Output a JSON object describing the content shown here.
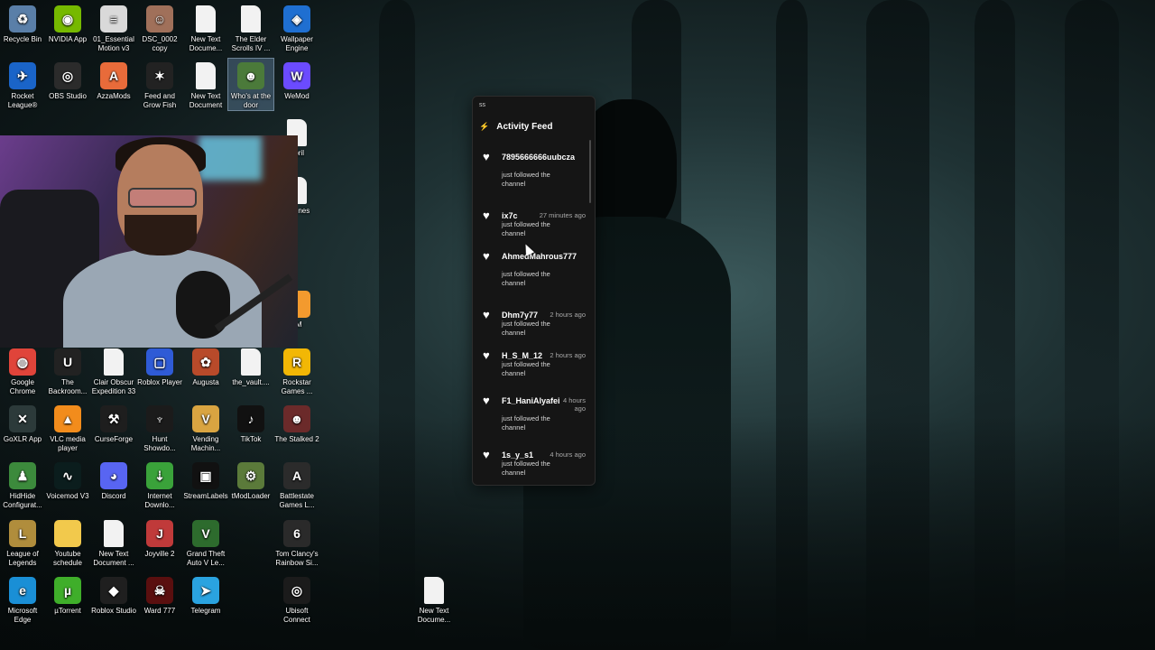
{
  "desktop": {
    "icons_top": [
      {
        "label": "Recycle Bin",
        "icon": "recycle-bin-icon",
        "color": "#5a7fa8",
        "glyph": "♻"
      },
      {
        "label": "NVIDIA App",
        "icon": "nvidia-icon",
        "color": "#76b900",
        "glyph": "◉"
      },
      {
        "label": "01_Essential Motion v3",
        "icon": "preset-file-icon",
        "color": "#d9d9d9",
        "glyph": "≡"
      },
      {
        "label": "DSC_0002 copy",
        "icon": "photo-icon",
        "color": "#a0705a",
        "glyph": "☺"
      },
      {
        "label": "New Text Docume...",
        "icon": "text-file-icon",
        "color": "#f2f2f2",
        "glyph": ""
      },
      {
        "label": "The Elder Scrolls IV ...",
        "icon": "text-file-icon",
        "color": "#f2f2f2",
        "glyph": ""
      },
      {
        "label": "Wallpaper Engine",
        "icon": "wallpaper-engine-icon",
        "color": "#1f6fd1",
        "glyph": "◈"
      }
    ],
    "icons_row2": [
      {
        "label": "Rocket League®",
        "icon": "rocket-league-icon",
        "color": "#1a64c8",
        "glyph": "✈"
      },
      {
        "label": "OBS Studio",
        "icon": "obs-icon",
        "color": "#2b2b2b",
        "glyph": "◎"
      },
      {
        "label": "AzzaMods",
        "icon": "azzamods-icon",
        "color": "#e86b3a",
        "glyph": "A"
      },
      {
        "label": "Feed and Grow Fish",
        "icon": "game-icon",
        "color": "#222222",
        "glyph": "✶"
      },
      {
        "label": "New Text Document",
        "icon": "text-file-icon",
        "color": "#f2f2f2",
        "glyph": ""
      },
      {
        "label": "Who's at the door",
        "icon": "game-icon",
        "color": "#4b7a3a",
        "glyph": "☻"
      },
      {
        "label": "WeMod",
        "icon": "wemod-icon",
        "color": "#6b4bff",
        "glyph": "W"
      }
    ],
    "icons_right_partial": [
      {
        "label": "April",
        "icon": "text-file-icon",
        "color": "#f2f2f2",
        "glyph": ""
      },
      {
        "label": "ube nes",
        "icon": "text-file-icon",
        "color": "#f2f2f2",
        "glyph": ""
      },
      {
        "label": "eM",
        "icon": "app-icon",
        "color": "#f39a2e",
        "glyph": ""
      }
    ],
    "icons_row3": [
      {
        "label": "Google Chrome",
        "icon": "chrome-icon",
        "color": "#e0443a",
        "glyph": "◍"
      },
      {
        "label": "The Backroom...",
        "icon": "unreal-icon",
        "color": "#222222",
        "glyph": "U"
      },
      {
        "label": "Clair Obscur Expedition 33",
        "icon": "text-file-icon",
        "color": "#f2f2f2",
        "glyph": ""
      },
      {
        "label": "Roblox Player",
        "icon": "roblox-icon",
        "color": "#2f5bd6",
        "glyph": "▢"
      },
      {
        "label": "Augusta",
        "icon": "game-icon",
        "color": "#b84a2a",
        "glyph": "✿"
      },
      {
        "label": "the_vault....",
        "icon": "text-file-icon",
        "color": "#f2f2f2",
        "glyph": ""
      },
      {
        "label": "Rockstar Games ...",
        "icon": "rockstar-icon",
        "color": "#f2b705",
        "glyph": "R"
      }
    ],
    "icons_row4": [
      {
        "label": "GoXLR App",
        "icon": "goxlr-icon",
        "color": "#2c3a3a",
        "glyph": "✕"
      },
      {
        "label": "VLC media player",
        "icon": "vlc-icon",
        "color": "#f28c1c",
        "glyph": "▲"
      },
      {
        "label": "CurseForge",
        "icon": "curseforge-icon",
        "color": "#1e1e1e",
        "glyph": "⚒"
      },
      {
        "label": "Hunt Showdo...",
        "icon": "game-icon",
        "color": "#1b1b1b",
        "glyph": "♆"
      },
      {
        "label": "Vending Machin...",
        "icon": "game-icon",
        "color": "#d9a441",
        "glyph": "V"
      },
      {
        "label": "TikTok",
        "icon": "tiktok-icon",
        "color": "#111111",
        "glyph": "♪"
      },
      {
        "label": "The Stalked 2",
        "icon": "game-icon",
        "color": "#6b2a2a",
        "glyph": "☻"
      }
    ],
    "icons_row5": [
      {
        "label": "HidHide Configurat...",
        "icon": "hidhide-icon",
        "color": "#3c8a3c",
        "glyph": "♟"
      },
      {
        "label": "Voicemod V3",
        "icon": "voicemod-icon",
        "color": "#0b1d1d",
        "glyph": "∿"
      },
      {
        "label": "Discord",
        "icon": "discord-icon",
        "color": "#5865f2",
        "glyph": "◕"
      },
      {
        "label": "Internet Downlo...",
        "icon": "idm-icon",
        "color": "#3aa23a",
        "glyph": "⇣"
      },
      {
        "label": "StreamLabels",
        "icon": "streamlabels-icon",
        "color": "#111111",
        "glyph": "▣"
      },
      {
        "label": "tModLoader",
        "icon": "tmodloader-icon",
        "color": "#5b7a3a",
        "glyph": "⚙"
      },
      {
        "label": "Battlestate Games L...",
        "icon": "battlestate-icon",
        "color": "#2b2b2b",
        "glyph": "A"
      }
    ],
    "icons_row6": [
      {
        "label": "League of Legends",
        "icon": "league-icon",
        "color": "#b08d3c",
        "glyph": "L"
      },
      {
        "label": "Youtube schedule",
        "icon": "folder-icon",
        "color": "#f2c94c",
        "glyph": ""
      },
      {
        "label": "New Text Document ...",
        "icon": "text-file-icon",
        "color": "#f2f2f2",
        "glyph": ""
      },
      {
        "label": "Joyville 2",
        "icon": "game-icon",
        "color": "#c03a3a",
        "glyph": "J"
      },
      {
        "label": "Grand Theft Auto V Le...",
        "icon": "gta-icon",
        "color": "#2d6b2d",
        "glyph": "V"
      },
      {
        "label": "Tom Clancy's Rainbow Si...",
        "icon": "r6-icon",
        "color": "#2a2a2a",
        "glyph": "6"
      }
    ],
    "icons_row7": [
      {
        "label": "Microsoft Edge",
        "icon": "edge-icon",
        "color": "#1a8fd6",
        "glyph": "e"
      },
      {
        "label": "µTorrent",
        "icon": "utorrent-icon",
        "color": "#3fae2a",
        "glyph": "µ"
      },
      {
        "label": "Roblox Studio",
        "icon": "roblox-studio-icon",
        "color": "#1f1f1f",
        "glyph": "◆"
      },
      {
        "label": "Ward 777",
        "icon": "game-icon",
        "color": "#5a0f0f",
        "glyph": "☠"
      },
      {
        "label": "Telegram",
        "icon": "telegram-icon",
        "color": "#2aa3e0",
        "glyph": "➤"
      },
      {
        "label": "Ubisoft Connect",
        "icon": "ubisoft-icon",
        "color": "#1b1b1b",
        "glyph": "◎"
      }
    ],
    "loose_icon": {
      "label": "New Text Docume...",
      "icon": "text-file-icon",
      "color": "#f2f2f2",
      "glyph": ""
    }
  },
  "feed": {
    "top_label": "ss",
    "title": "Activity Feed",
    "entries": [
      {
        "name": "7895666666uubcza",
        "time": "",
        "message": "just followed the channel"
      },
      {
        "name": "ix7c",
        "time": "27 minutes ago",
        "message": "just followed the channel"
      },
      {
        "name": "AhmedMahrous777",
        "time": "",
        "message": "just followed the channel"
      },
      {
        "name": "Dhm7y77",
        "time": "2 hours ago",
        "message": "just followed the channel"
      },
      {
        "name": "H_S_M_12",
        "time": "2 hours ago",
        "message": "just followed the channel"
      },
      {
        "name": "F1_HaniAlyafei",
        "time": "4 hours ago",
        "message": "just followed the channel"
      },
      {
        "name": "1s_y_s1",
        "time": "4 hours ago",
        "message": "just followed the channel"
      }
    ]
  }
}
